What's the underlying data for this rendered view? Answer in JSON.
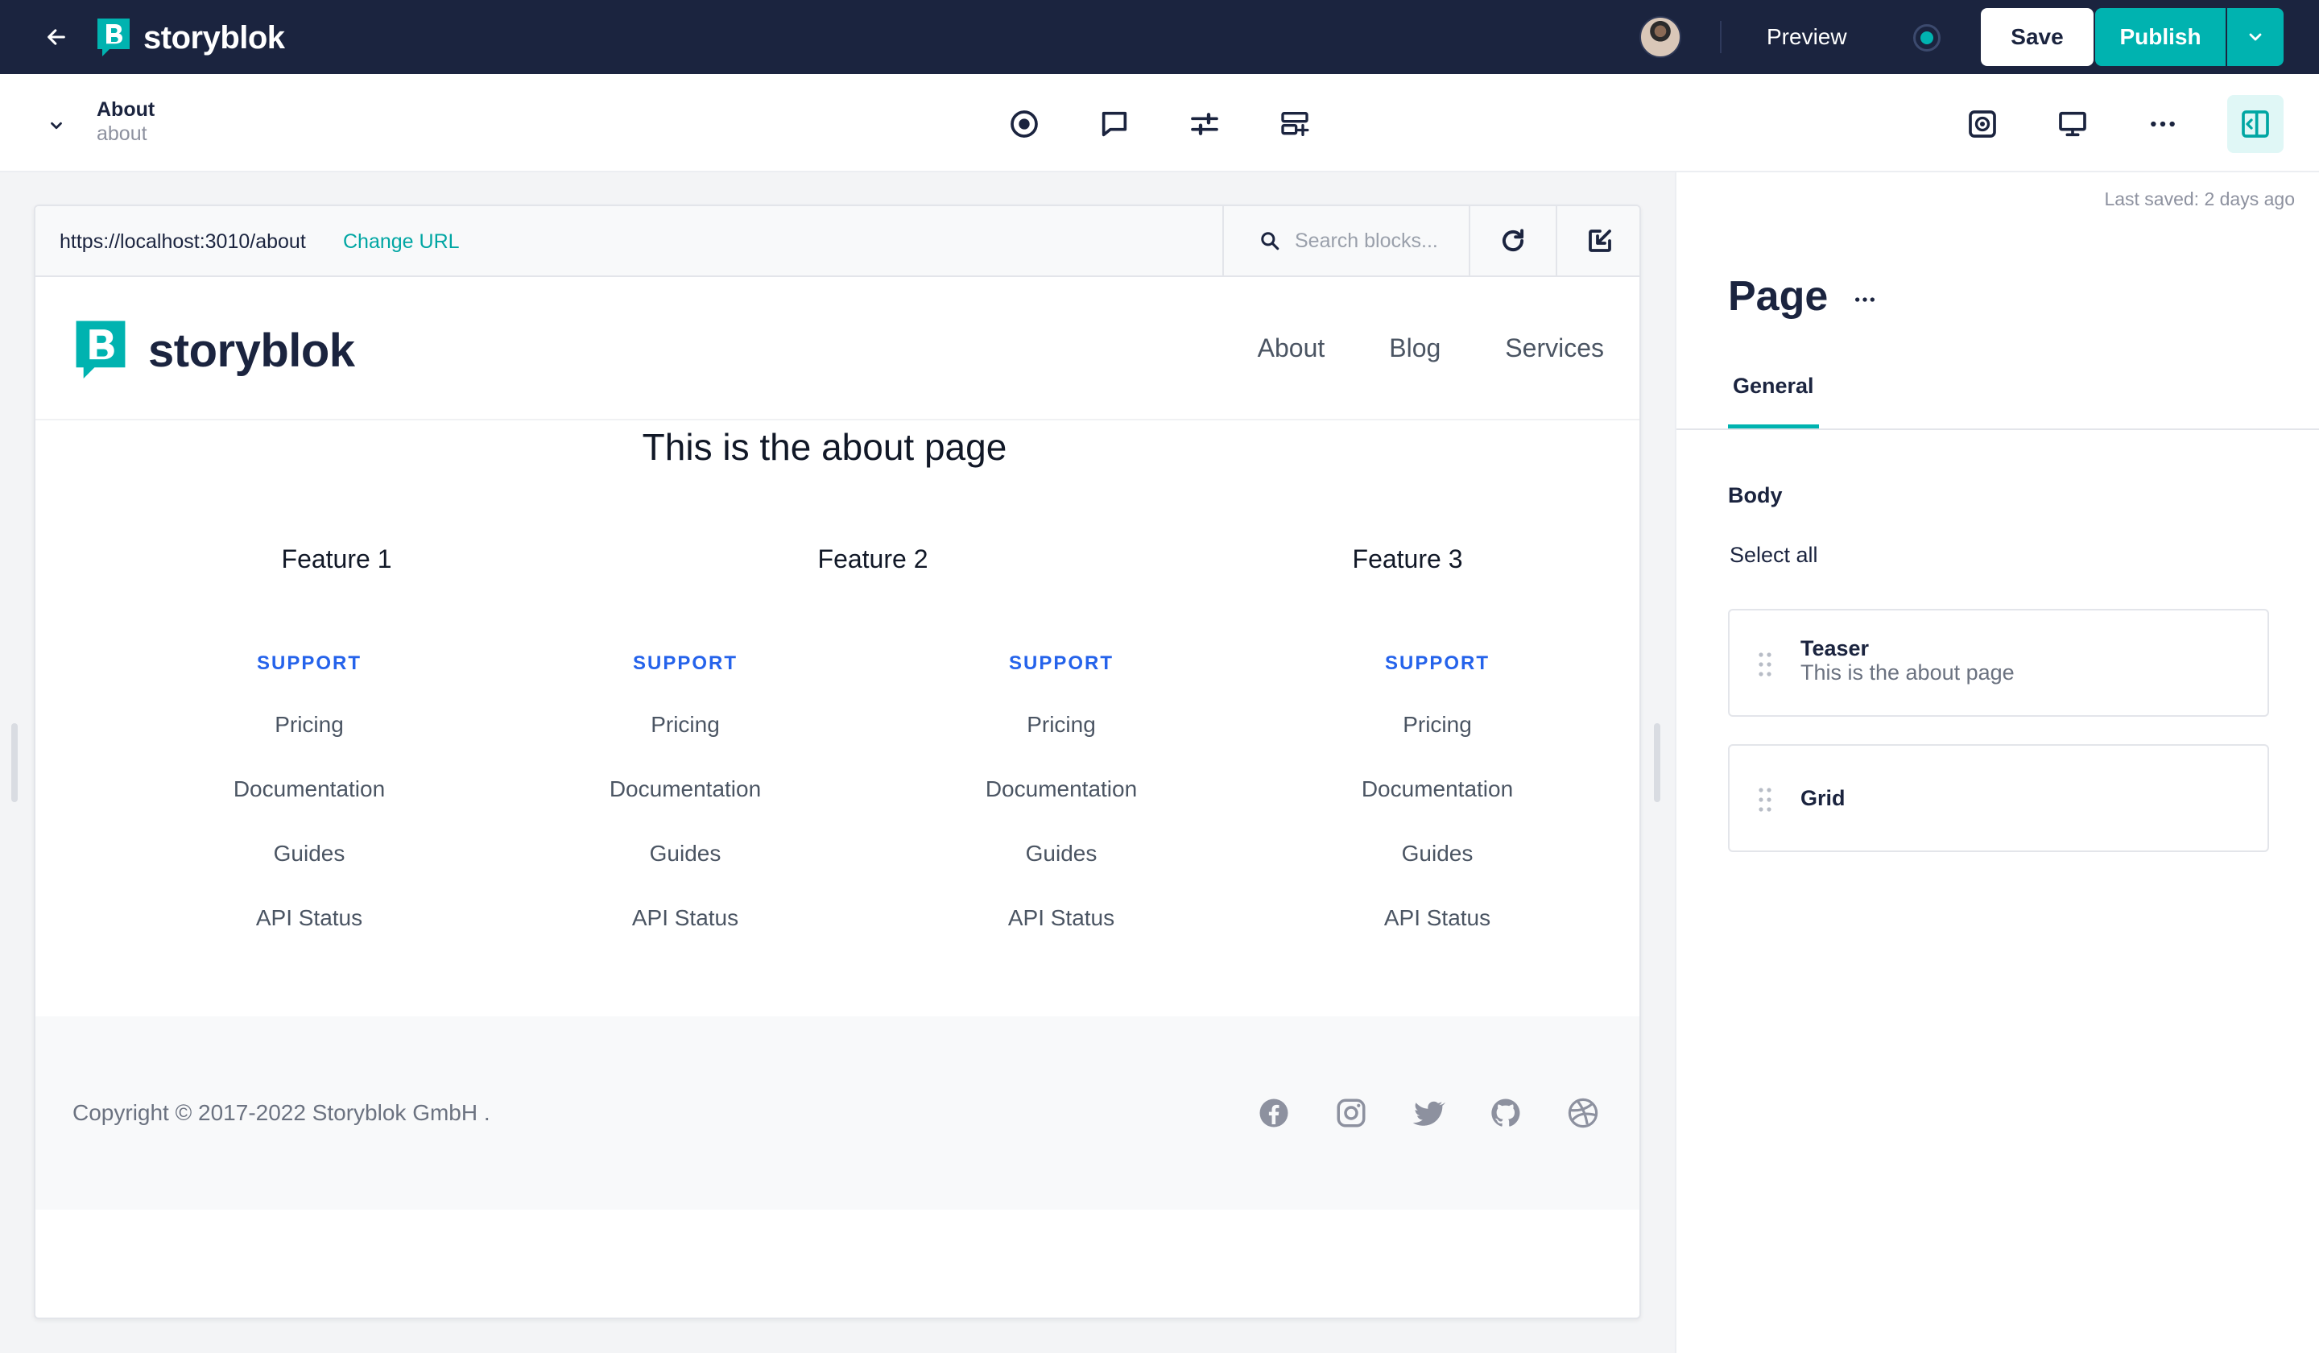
{
  "app": {
    "brand": "storyblok",
    "preview_label": "Preview",
    "save_label": "Save",
    "publish_label": "Publish"
  },
  "story": {
    "name": "About",
    "slug": "about"
  },
  "toolbar": {
    "icons": [
      "target-icon",
      "comment-icon",
      "sliders-icon",
      "add-block-icon",
      "screenshot-icon",
      "desktop-icon",
      "more-icon",
      "panel-toggle-icon"
    ]
  },
  "preview": {
    "url": "https://localhost:3010/about",
    "change_url_label": "Change URL",
    "search_placeholder": "Search blocks..."
  },
  "site": {
    "logo_text": "storyblok",
    "nav": [
      "About",
      "Blog",
      "Services"
    ],
    "hero_title": "This is the about page",
    "features": [
      "Feature 1",
      "Feature 2",
      "Feature 3"
    ],
    "columns": [
      {
        "heading": "SUPPORT",
        "links": [
          "Pricing",
          "Documentation",
          "Guides",
          "API Status"
        ]
      },
      {
        "heading": "SUPPORT",
        "links": [
          "Pricing",
          "Documentation",
          "Guides",
          "API Status"
        ]
      },
      {
        "heading": "SUPPORT",
        "links": [
          "Pricing",
          "Documentation",
          "Guides",
          "API Status"
        ]
      },
      {
        "heading": "SUPPORT",
        "links": [
          "Pricing",
          "Documentation",
          "Guides",
          "API Status"
        ]
      }
    ],
    "copyright": "Copyright © 2017-2022  Storyblok GmbH  .",
    "social_icons": [
      "facebook-icon",
      "instagram-icon",
      "twitter-icon",
      "github-icon",
      "dribbble-icon"
    ]
  },
  "panel": {
    "last_saved": "Last saved: 2 days ago",
    "title": "Page",
    "tabs": [
      "General"
    ],
    "field_label": "Body",
    "select_all": "Select all",
    "blocks": [
      {
        "name": "Teaser",
        "description": "This is the about page"
      },
      {
        "name": "Grid",
        "description": ""
      }
    ]
  },
  "colors": {
    "topbar": "#1b243f",
    "accent": "#00b3b0",
    "link_blue": "#2563eb"
  }
}
